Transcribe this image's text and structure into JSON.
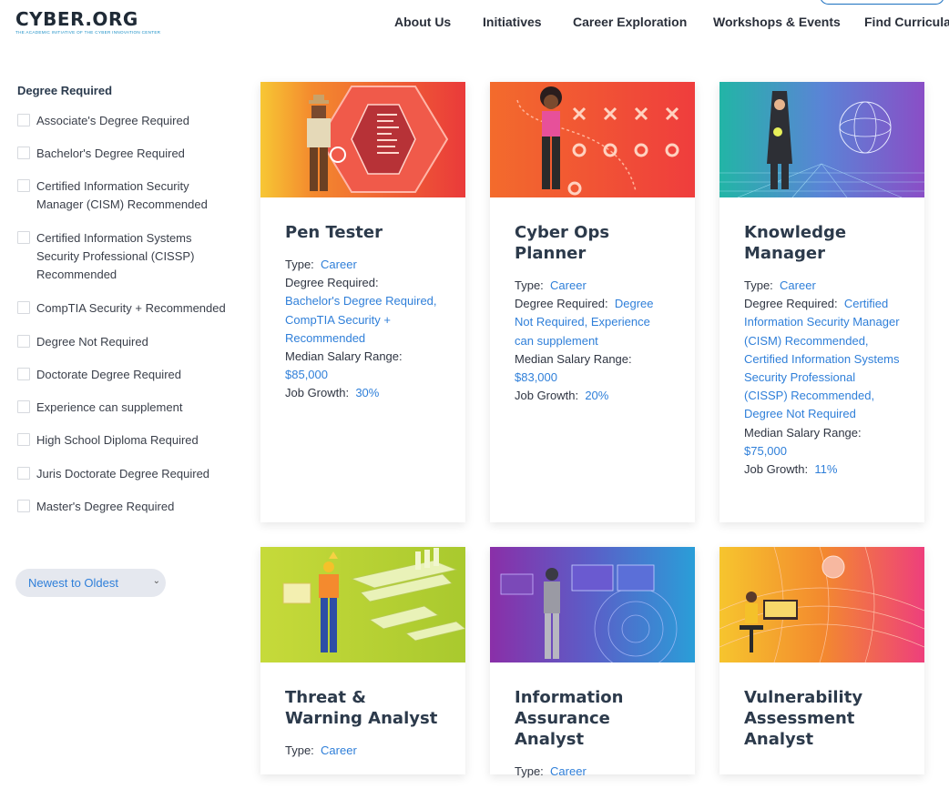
{
  "logo": {
    "name": "CYBER.ORG",
    "tagline": "THE ACADEMIC INITIATIVE OF THE CYBER INNOVATION CENTER"
  },
  "nav": [
    "About Us",
    "Initiatives",
    "Career Exploration",
    "Workshops & Events",
    "Find Curricula"
  ],
  "filters": {
    "title": "Degree Required",
    "items": [
      "Associate's Degree Required",
      "Bachelor's Degree Required",
      "Certified Information Security Manager (CISM) Recommended",
      "Certified Information Systems Security Professional (CISSP) Recommended",
      "CompTIA Security + Recommended",
      "Degree Not Required",
      "Doctorate Degree Required",
      "Experience can supplement",
      "High School Diploma Required",
      "Juris Doctorate Degree Required",
      "Master's Degree Required"
    ]
  },
  "sort": {
    "selected": "Newest to Oldest"
  },
  "labels": {
    "type": "Type:",
    "degree": "Degree Required:",
    "salary": "Median Salary Range:",
    "growth": "Job Growth:"
  },
  "cards": [
    {
      "title": "Pen Tester",
      "type": "Career",
      "degree": "Bachelor's Degree Required, CompTIA Security + Recommended",
      "salary": "$85,000",
      "growth": "30%"
    },
    {
      "title": "Cyber Ops Planner",
      "type": "Career",
      "degree": "Degree Not Required, Experience can supplement",
      "salary": "$83,000",
      "growth": "20%"
    },
    {
      "title": "Knowledge Manager",
      "type": "Career",
      "degree": "Certified Information Security Manager (CISM) Recommended, Certified Information Systems Security Professional (CISSP) Recommended, Degree Not Required",
      "salary": "$75,000",
      "growth": "11%"
    },
    {
      "title": "Threat & Warning Analyst",
      "type": "Career"
    },
    {
      "title": "Information Assurance Analyst",
      "type": "Career"
    },
    {
      "title": "Vulnerability Assessment Analyst"
    }
  ],
  "colors": {
    "accent": "#2f7fd9",
    "title": "#2c3a4b",
    "brand": "#1f2a36"
  }
}
